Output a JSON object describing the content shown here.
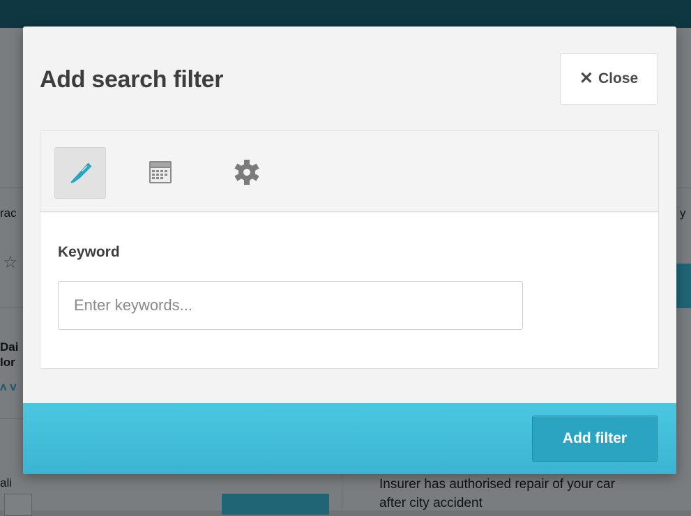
{
  "background": {
    "partial_texts": [
      "rac",
      "y",
      "Dai",
      "lor",
      "ali",
      "Insurer has authorised repair of your car",
      "after city accident"
    ]
  },
  "modal": {
    "title": "Add search filter",
    "close_label": "Close",
    "tabs": [
      {
        "icon": "pencil-icon",
        "active": true
      },
      {
        "icon": "calendar-icon",
        "active": false
      },
      {
        "icon": "gear-icon",
        "active": false
      }
    ],
    "keyword": {
      "label": "Keyword",
      "placeholder": "Enter keywords...",
      "value": ""
    },
    "add_filter_label": "Add filter"
  },
  "colors": {
    "accent": "#3ab4d2",
    "button": "#2aa4c0",
    "active_icon": "#2aa4c0",
    "title_text": "#3d3d3d"
  }
}
